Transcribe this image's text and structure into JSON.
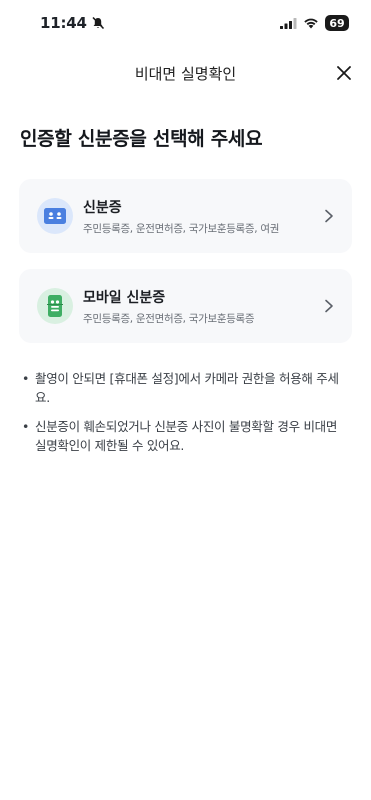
{
  "status_bar": {
    "time": "11:44",
    "battery": "69"
  },
  "nav": {
    "title": "비대면 실명확인"
  },
  "heading": "인증할 신분증을 선택해 주세요",
  "options": [
    {
      "title": "신분증",
      "desc": "주민등록증, 운전면허증, 국가보훈등록증, 여권",
      "icon": "id-card-icon",
      "color": "#4a7fe0"
    },
    {
      "title": "모바일 신분증",
      "desc": "주민등록증, 운전면허증, 국가보훈등록증",
      "icon": "mobile-id-icon",
      "color": "#3fae64"
    }
  ],
  "notes": [
    "촬영이 안되면 [휴대폰 설정]에서 카메라 권한을 허용해 주세요.",
    "신분증이 훼손되었거나 신분증 사진이 불명확할 경우 비대면 실명확인이 제한될 수 있어요."
  ]
}
